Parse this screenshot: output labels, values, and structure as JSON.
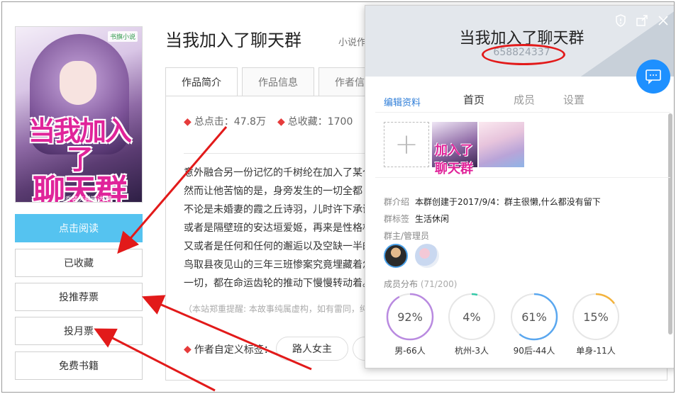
{
  "book": {
    "title": "当我加入了聊天群",
    "author_short": "小说作",
    "cover": {
      "logo": "书旗小说",
      "title_line1": "当我加入了",
      "title_line2": "聊天群",
      "author_art": "乔装夫越斯达/著"
    }
  },
  "actions": {
    "read": "点击阅读",
    "collected": "已收藏",
    "recommend": "投推荐票",
    "monthly": "投月票",
    "free": "免费书籍"
  },
  "tabs": [
    "作品简介",
    "作品信息",
    "作者信息"
  ],
  "stats": {
    "clicks": "总点击：47.8万",
    "favorites": "总收藏：1700"
  },
  "intro": [
    "意外融合另一份记忆的千树纶在加入了某个",
    "然而让他苦恼的是，身旁发生的一切全都",
    "不论是未婚妻的霞之丘诗羽，儿时许下承诺",
    "或者是隔壁班的安达垣爱姬，再来是性格相",
    "又或者是任何和任何的邂逅以及空缺一半的",
    "鸟取县夜见山的三年三班惨案究竟埋藏着怎",
    "一切，都在命运齿轮的推动下慢慢转动着。"
  ],
  "notice": "（本站郑重提醒: 本故事纯属虚构，如有雷同，纯",
  "custom_tags": {
    "label": "作者自定义标签：",
    "tag1": "路人女主"
  },
  "group_popup": {
    "name": "当我加入了聊天群",
    "id": "658824337",
    "nav": {
      "edit": "编辑资料",
      "tabs": [
        "首页",
        "成员",
        "设置"
      ]
    },
    "intro_label": "群介绍",
    "intro_value": "本群创建于2017/9/4：群主很懒,什么都没有留下",
    "tag_label": "群标签",
    "tag_value": "生活休闲",
    "admins_label": "群主/管理员",
    "distribution_label": "成员分布",
    "distribution_count": "(71/200)",
    "distribution": [
      {
        "pct": "92%",
        "label": "男-66人",
        "value": 0.92,
        "color": "#b98ae0"
      },
      {
        "pct": "4%",
        "label": "杭州-3人",
        "value": 0.04,
        "color": "#35c9a8"
      },
      {
        "pct": "61%",
        "label": "90后-44人",
        "value": 0.61,
        "color": "#5aa7ef"
      },
      {
        "pct": "15%",
        "label": "单身-11人",
        "value": 0.15,
        "color": "#f3b33d"
      }
    ]
  },
  "colors": {
    "accent": "#55c3f0",
    "annotation_red": "#e21a1a",
    "link_blue": "#2f7ed8"
  }
}
